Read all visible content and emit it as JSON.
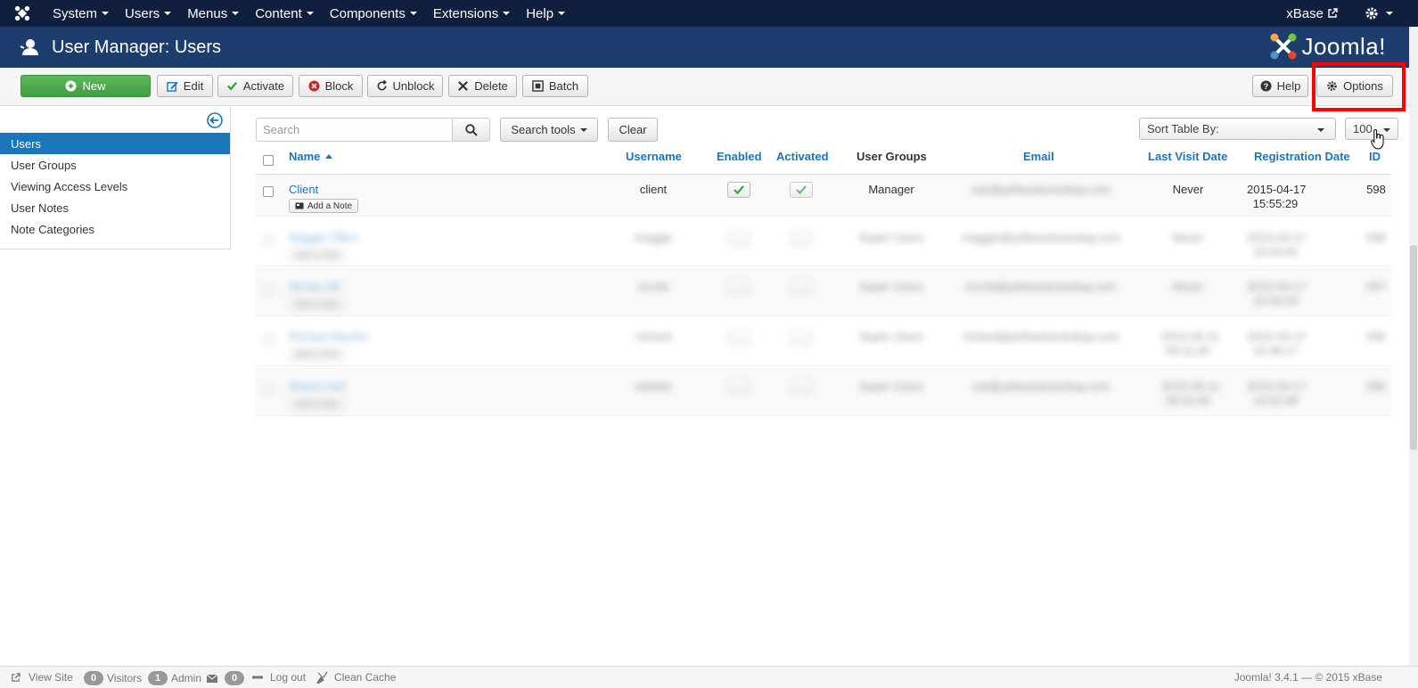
{
  "navbar": {
    "menu": [
      "System",
      "Users",
      "Menus",
      "Content",
      "Components",
      "Extensions",
      "Help"
    ],
    "site_name": "xBase"
  },
  "header": {
    "title": "User Manager: Users",
    "brand": "Joomla!"
  },
  "toolbar": {
    "new": "New",
    "edit": "Edit",
    "activate": "Activate",
    "block": "Block",
    "unblock": "Unblock",
    "delete": "Delete",
    "batch": "Batch",
    "help": "Help",
    "options": "Options"
  },
  "sidebar": {
    "items": [
      {
        "label": "Users",
        "active": true
      },
      {
        "label": "User Groups",
        "active": false
      },
      {
        "label": "Viewing Access Levels",
        "active": false
      },
      {
        "label": "User Notes",
        "active": false
      },
      {
        "label": "Note Categories",
        "active": false
      }
    ]
  },
  "filters": {
    "search_placeholder": "Search",
    "search_tools": "Search tools",
    "clear": "Clear",
    "sort_by": "Sort Table By:",
    "limit": "100"
  },
  "table": {
    "columns": [
      "Name",
      "Username",
      "Enabled",
      "Activated",
      "User Groups",
      "Email",
      "Last Visit Date",
      "Registration Date",
      "ID"
    ],
    "rows": [
      {
        "name": "Client",
        "add_note": "Add a Note",
        "username": "client",
        "group": "Manager",
        "email": "sue@yellowstonesbay.com",
        "last_visit": "Never",
        "reg_date": "2015-04-17",
        "reg_time": "15:55:29",
        "id": "598"
      },
      {
        "name": "Maggie Tiffen",
        "add_note": "Add a Note",
        "username": "maggie",
        "group": "Super Users",
        "email": "maggie@yellowstonesbay.com",
        "last_visit": "Never",
        "reg_date": "2015-04-17",
        "reg_time": "15:54:55",
        "id": "599"
      },
      {
        "name": "Nicola Hill",
        "add_note": "Add a Note",
        "username": "nicola",
        "group": "Super Users",
        "email": "nicola@yellowstonesbay.com",
        "last_visit": "Never",
        "reg_date": "2015-04-17",
        "reg_time": "15:56:03",
        "id": "597"
      },
      {
        "name": "Richard Mackin",
        "add_note": "Add a Note",
        "username": "richard",
        "group": "Super Users",
        "email": "richard@yellowstonesbay.com",
        "last_visit": "2015-05-11",
        "last_visit_time": "09:11:00",
        "reg_date": "2015-04-17",
        "reg_time": "15:48:17",
        "id": "595"
      },
      {
        "name": "Robert Ash",
        "add_note": "Add a Note",
        "username": "webbie",
        "group": "Super Users",
        "email": "rob@yellowstonesbay.com",
        "last_visit": "2015-05-11",
        "last_visit_time": "09:22:00",
        "reg_date": "2015-04-17",
        "reg_time": "14:52:08",
        "id": "596"
      }
    ]
  },
  "footer": {
    "view_site": "View Site",
    "visitors_count": "0",
    "visitors": "Visitors",
    "admin_count": "1",
    "admin": "Admin",
    "messages_count": "0",
    "logout": "Log out",
    "clean_cache": "Clean Cache",
    "version": "Joomla! 3.4.1 — © 2015 xBase"
  }
}
